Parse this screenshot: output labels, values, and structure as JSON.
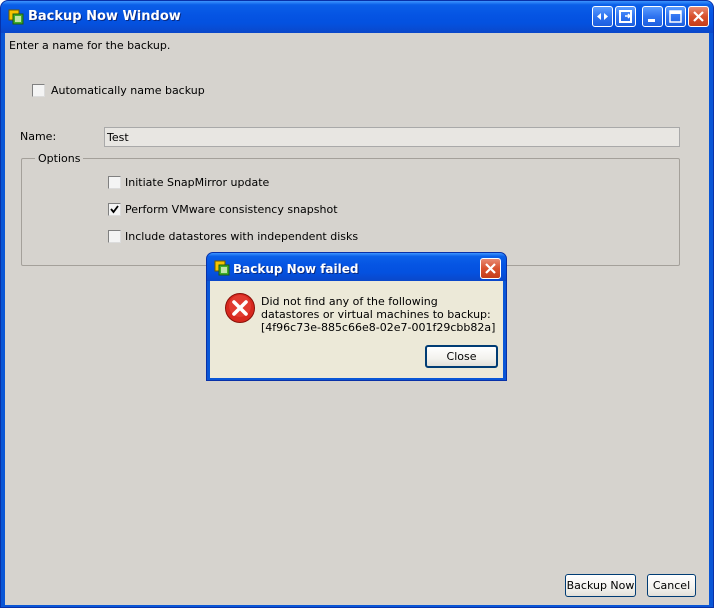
{
  "window": {
    "title": "Backup Now Window",
    "buttons": [
      "restore-arrows",
      "export",
      "minimize",
      "maximize",
      "close"
    ]
  },
  "form": {
    "instruction": "Enter a name for the backup.",
    "auto_name": {
      "label": "Automatically name backup",
      "checked": false
    },
    "name_label": "Name:",
    "name_value": "Test",
    "options_legend": "Options",
    "options": [
      {
        "label": "Initiate SnapMirror update",
        "checked": false
      },
      {
        "label": "Perform VMware consistency snapshot",
        "checked": true
      },
      {
        "label": "Include datastores with independent disks",
        "checked": false
      }
    ]
  },
  "footer": {
    "backup_now": "Backup Now",
    "cancel": "Cancel"
  },
  "dialog": {
    "title": "Backup Now failed",
    "message": "Did not find any of the following datastores or virtual machines to backup: [4f96c73e-885c66e8-02e7-001f29cbb82a]",
    "close_label": "Close",
    "icon": "error-icon"
  },
  "colors": {
    "titlebar": "#0554e3",
    "client_bg": "#d6d3ce",
    "dialog_bg": "#ece9d8",
    "error_red": "#d7281e"
  }
}
